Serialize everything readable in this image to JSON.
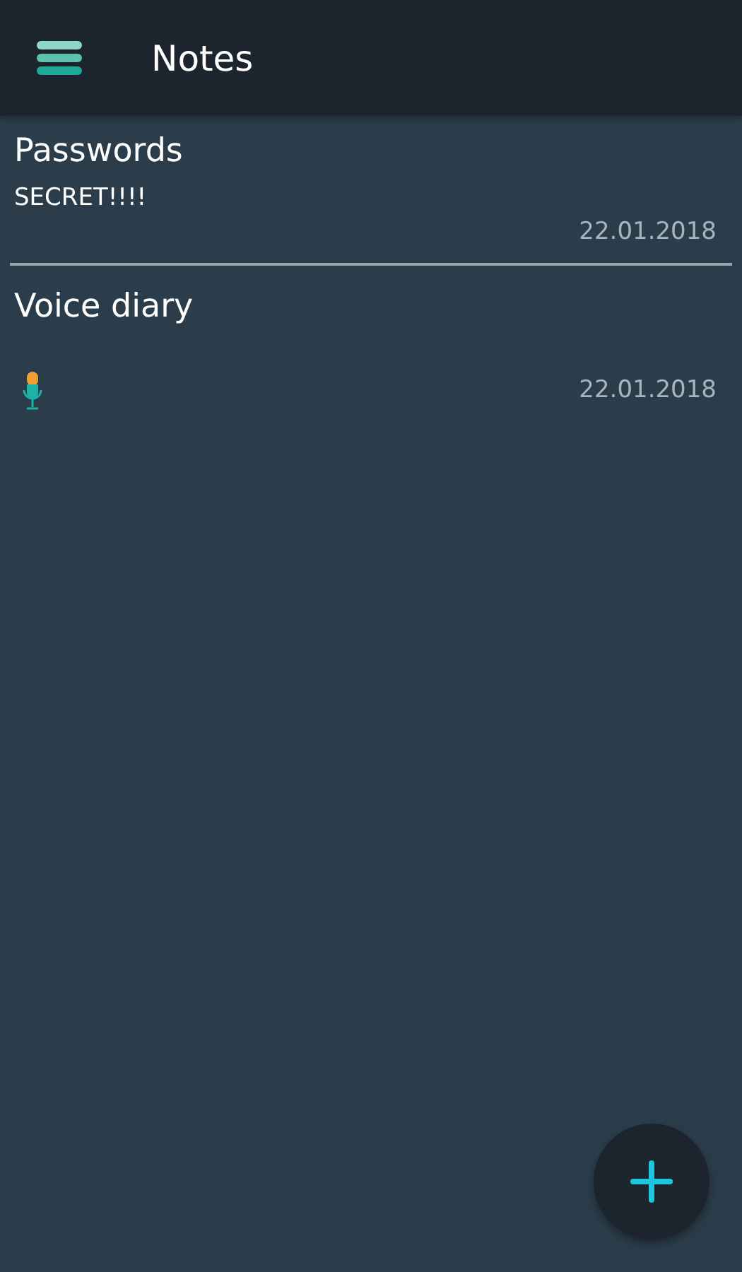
{
  "app_bar": {
    "title": "Notes"
  },
  "notes": [
    {
      "kind": "text",
      "title": "Passwords",
      "body": "SECRET!!!!",
      "date": "22.01.2018"
    },
    {
      "kind": "voice",
      "title": "Voice diary",
      "date": "22.01.2018"
    }
  ]
}
